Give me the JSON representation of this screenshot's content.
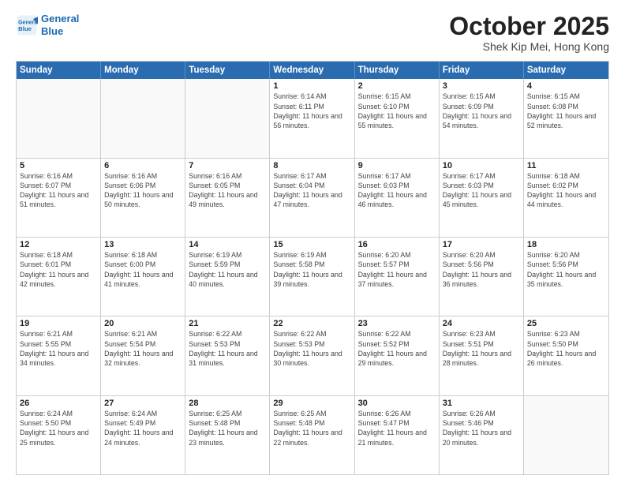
{
  "header": {
    "logo_line1": "General",
    "logo_line2": "Blue",
    "month": "October 2025",
    "location": "Shek Kip Mei, Hong Kong"
  },
  "day_headers": [
    "Sunday",
    "Monday",
    "Tuesday",
    "Wednesday",
    "Thursday",
    "Friday",
    "Saturday"
  ],
  "weeks": [
    [
      {
        "num": "",
        "info": ""
      },
      {
        "num": "",
        "info": ""
      },
      {
        "num": "",
        "info": ""
      },
      {
        "num": "1",
        "info": "Sunrise: 6:14 AM\nSunset: 6:11 PM\nDaylight: 11 hours and 56 minutes."
      },
      {
        "num": "2",
        "info": "Sunrise: 6:15 AM\nSunset: 6:10 PM\nDaylight: 11 hours and 55 minutes."
      },
      {
        "num": "3",
        "info": "Sunrise: 6:15 AM\nSunset: 6:09 PM\nDaylight: 11 hours and 54 minutes."
      },
      {
        "num": "4",
        "info": "Sunrise: 6:15 AM\nSunset: 6:08 PM\nDaylight: 11 hours and 52 minutes."
      }
    ],
    [
      {
        "num": "5",
        "info": "Sunrise: 6:16 AM\nSunset: 6:07 PM\nDaylight: 11 hours and 51 minutes."
      },
      {
        "num": "6",
        "info": "Sunrise: 6:16 AM\nSunset: 6:06 PM\nDaylight: 11 hours and 50 minutes."
      },
      {
        "num": "7",
        "info": "Sunrise: 6:16 AM\nSunset: 6:05 PM\nDaylight: 11 hours and 49 minutes."
      },
      {
        "num": "8",
        "info": "Sunrise: 6:17 AM\nSunset: 6:04 PM\nDaylight: 11 hours and 47 minutes."
      },
      {
        "num": "9",
        "info": "Sunrise: 6:17 AM\nSunset: 6:03 PM\nDaylight: 11 hours and 46 minutes."
      },
      {
        "num": "10",
        "info": "Sunrise: 6:17 AM\nSunset: 6:03 PM\nDaylight: 11 hours and 45 minutes."
      },
      {
        "num": "11",
        "info": "Sunrise: 6:18 AM\nSunset: 6:02 PM\nDaylight: 11 hours and 44 minutes."
      }
    ],
    [
      {
        "num": "12",
        "info": "Sunrise: 6:18 AM\nSunset: 6:01 PM\nDaylight: 11 hours and 42 minutes."
      },
      {
        "num": "13",
        "info": "Sunrise: 6:18 AM\nSunset: 6:00 PM\nDaylight: 11 hours and 41 minutes."
      },
      {
        "num": "14",
        "info": "Sunrise: 6:19 AM\nSunset: 5:59 PM\nDaylight: 11 hours and 40 minutes."
      },
      {
        "num": "15",
        "info": "Sunrise: 6:19 AM\nSunset: 5:58 PM\nDaylight: 11 hours and 39 minutes."
      },
      {
        "num": "16",
        "info": "Sunrise: 6:20 AM\nSunset: 5:57 PM\nDaylight: 11 hours and 37 minutes."
      },
      {
        "num": "17",
        "info": "Sunrise: 6:20 AM\nSunset: 5:56 PM\nDaylight: 11 hours and 36 minutes."
      },
      {
        "num": "18",
        "info": "Sunrise: 6:20 AM\nSunset: 5:56 PM\nDaylight: 11 hours and 35 minutes."
      }
    ],
    [
      {
        "num": "19",
        "info": "Sunrise: 6:21 AM\nSunset: 5:55 PM\nDaylight: 11 hours and 34 minutes."
      },
      {
        "num": "20",
        "info": "Sunrise: 6:21 AM\nSunset: 5:54 PM\nDaylight: 11 hours and 32 minutes."
      },
      {
        "num": "21",
        "info": "Sunrise: 6:22 AM\nSunset: 5:53 PM\nDaylight: 11 hours and 31 minutes."
      },
      {
        "num": "22",
        "info": "Sunrise: 6:22 AM\nSunset: 5:53 PM\nDaylight: 11 hours and 30 minutes."
      },
      {
        "num": "23",
        "info": "Sunrise: 6:22 AM\nSunset: 5:52 PM\nDaylight: 11 hours and 29 minutes."
      },
      {
        "num": "24",
        "info": "Sunrise: 6:23 AM\nSunset: 5:51 PM\nDaylight: 11 hours and 28 minutes."
      },
      {
        "num": "25",
        "info": "Sunrise: 6:23 AM\nSunset: 5:50 PM\nDaylight: 11 hours and 26 minutes."
      }
    ],
    [
      {
        "num": "26",
        "info": "Sunrise: 6:24 AM\nSunset: 5:50 PM\nDaylight: 11 hours and 25 minutes."
      },
      {
        "num": "27",
        "info": "Sunrise: 6:24 AM\nSunset: 5:49 PM\nDaylight: 11 hours and 24 minutes."
      },
      {
        "num": "28",
        "info": "Sunrise: 6:25 AM\nSunset: 5:48 PM\nDaylight: 11 hours and 23 minutes."
      },
      {
        "num": "29",
        "info": "Sunrise: 6:25 AM\nSunset: 5:48 PM\nDaylight: 11 hours and 22 minutes."
      },
      {
        "num": "30",
        "info": "Sunrise: 6:26 AM\nSunset: 5:47 PM\nDaylight: 11 hours and 21 minutes."
      },
      {
        "num": "31",
        "info": "Sunrise: 6:26 AM\nSunset: 5:46 PM\nDaylight: 11 hours and 20 minutes."
      },
      {
        "num": "",
        "info": ""
      }
    ]
  ]
}
